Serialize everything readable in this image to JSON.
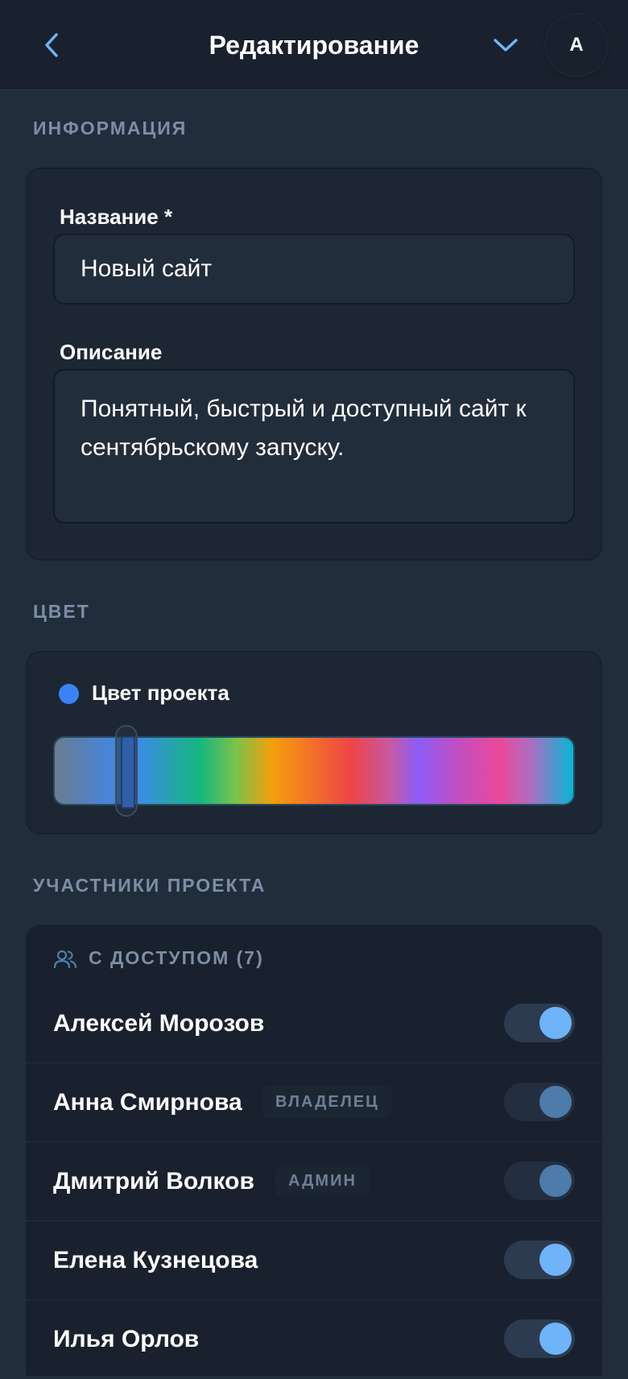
{
  "header": {
    "title": "Редактирование",
    "avatar_initial": "А"
  },
  "info_section": {
    "label": "ИНФОРМАЦИЯ",
    "name_label": "Название *",
    "name_value": "Новый сайт",
    "description_label": "Описание",
    "description_value": "Понятный, быстрый и доступный сайт к сентябрьскому запуску."
  },
  "color_section": {
    "label": "ЦВЕТ",
    "picker_label": "Цвет проекта",
    "selected_color": "#3b82f6",
    "hue_position": 0.14
  },
  "members_section": {
    "label": "УЧАСТНИКИ ПРОЕКТА",
    "group_label": "С ДОСТУПОМ (7)",
    "members": [
      {
        "name": "Алексей Морозов",
        "badge": "",
        "enabled": true,
        "locked": false
      },
      {
        "name": "Анна Смирнова",
        "badge": "ВЛАДЕЛЕЦ",
        "enabled": true,
        "locked": true
      },
      {
        "name": "Дмитрий Волков",
        "badge": "АДМИН",
        "enabled": true,
        "locked": true
      },
      {
        "name": "Елена Кузнецова",
        "badge": "",
        "enabled": true,
        "locked": false
      },
      {
        "name": "Илья Орлов",
        "badge": "",
        "enabled": true,
        "locked": false
      }
    ]
  },
  "colors": {
    "accent": "#6fb3f8",
    "background": "#222d3c",
    "header": "#18212d"
  },
  "icons": {
    "back": "chevron-left-icon",
    "dropdown": "chevron-down-icon",
    "members": "users-icon"
  }
}
